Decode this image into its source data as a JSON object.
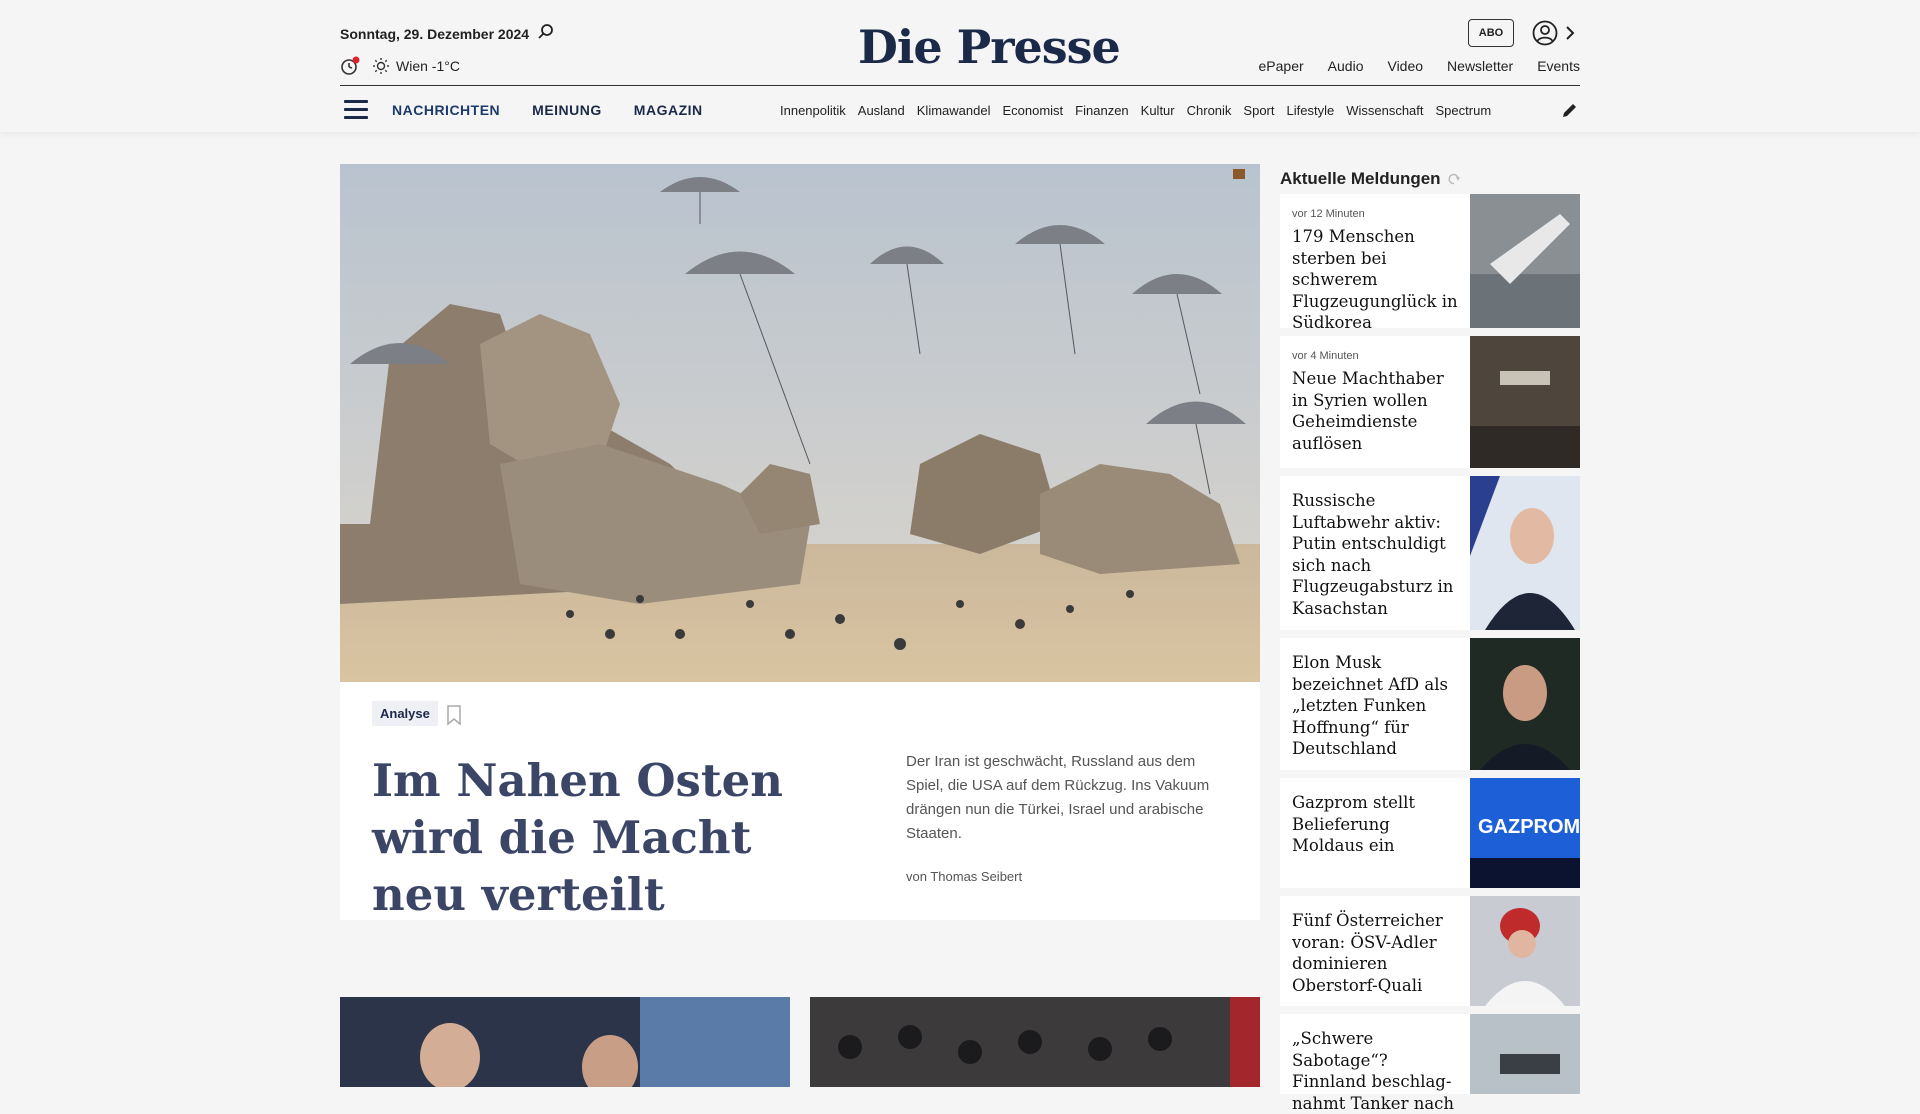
{
  "header": {
    "date": "Sonntag, 29. Dezember 2024",
    "weather": "Wien -1°C",
    "logo": "Die Presse",
    "abo_label": "ABO",
    "subnav": [
      "ePaper",
      "Audio",
      "Video",
      "Newsletter",
      "Events"
    ],
    "main_nav": [
      "NACHRICHTEN",
      "MEINUNG",
      "MAGAZIN"
    ],
    "categories": [
      "Innenpolitik",
      "Ausland",
      "Klimawandel",
      "Economist",
      "Finanzen",
      "Kultur",
      "Chronik",
      "Sport",
      "Lifestyle",
      "Wissenschaft",
      "Spectrum"
    ]
  },
  "hero": {
    "tag": "Analyse",
    "headline": "Im Nahen Osten wird die Macht neu verteilt",
    "teaser": "Der Iran ist geschwächt, Russland aus dem Spiel, die USA auf dem Rückzug. Ins Vakuum drängen nun die Türkei, Israel und arabische Staaten.",
    "author": "von Thomas Seibert"
  },
  "sidebar": {
    "title": "Aktuelle Meldungen",
    "items": [
      {
        "time": "vor 12 Minuten",
        "title": "179 Menschen sterben bei schwerem Flugzeug­unglück in Südkorea",
        "height": 134
      },
      {
        "time": "vor 4 Minuten",
        "title": "Neue Machthaber in Syrien wollen Geheimdienste auflösen",
        "height": 132
      },
      {
        "time": "",
        "title": "Russische Luftabwehr aktiv: Putin entschuldigt sich nach Flugzeugabsturz in Kasachstan",
        "height": 154
      },
      {
        "time": "",
        "title": "Elon Musk bezeichnet AfD als „letzten Funken Hoffnung“ für Deutschland",
        "height": 132
      },
      {
        "time": "",
        "title": "Gazprom stellt Belieferung Moldaus ein",
        "height": 110
      },
      {
        "time": "",
        "title": "Fünf Österreicher voran: ÖSV-Adler dominieren Oberstorf-Quali",
        "height": 110
      },
      {
        "time": "",
        "title": "„Schwere Sabotage“? Finnland beschlag­nahmt Tanker nach",
        "height": 80
      }
    ]
  },
  "colors": {
    "brand": "#1c2a4a",
    "headline": "#3b4566",
    "background": "#f5f5f5"
  }
}
